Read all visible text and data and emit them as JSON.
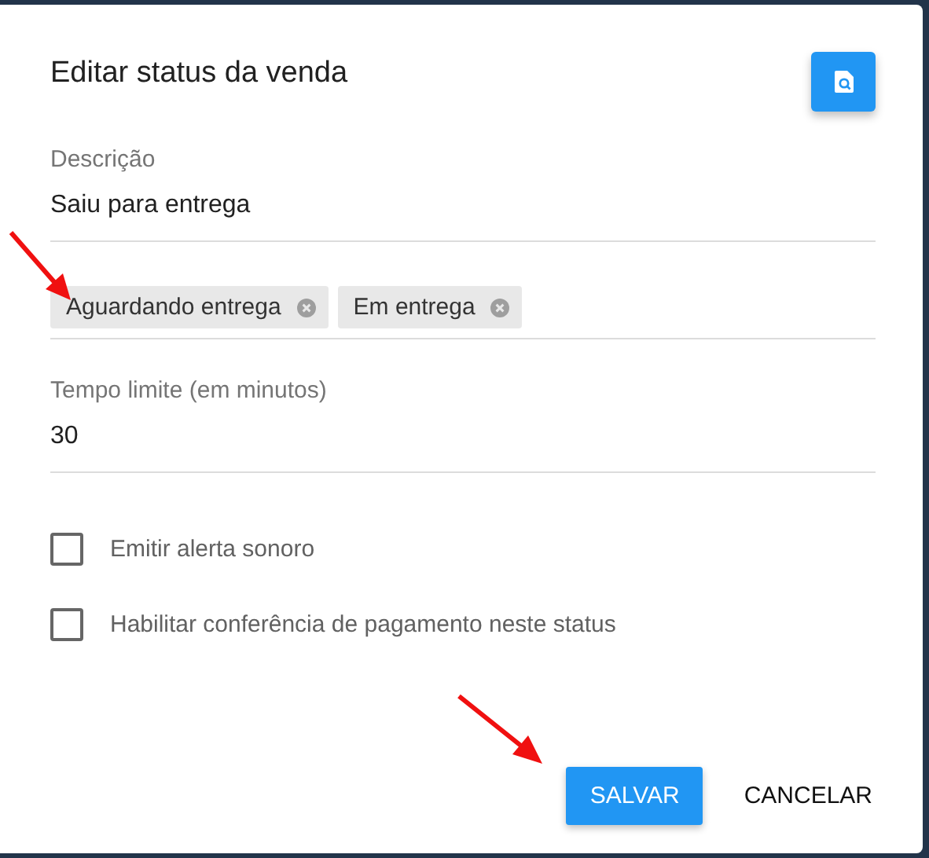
{
  "dialog": {
    "title": "Editar status da venda"
  },
  "fields": [
    {
      "kind": "text",
      "label": "Descrição",
      "value": "Saiu para entrega"
    },
    {
      "kind": "chips",
      "chips": [
        "Aguardando entrega",
        "Em entrega"
      ]
    },
    {
      "kind": "text",
      "label": "Tempo limite (em minutos)",
      "value": "30"
    }
  ],
  "checkboxes": [
    {
      "label": "Emitir alerta sonoro",
      "checked": false
    },
    {
      "label": "Habilitar conferência de pagamento neste status",
      "checked": false
    }
  ],
  "buttons": [
    {
      "label": "SALVAR",
      "kind": "primary"
    },
    {
      "label": "CANCELAR",
      "kind": "flat"
    }
  ]
}
